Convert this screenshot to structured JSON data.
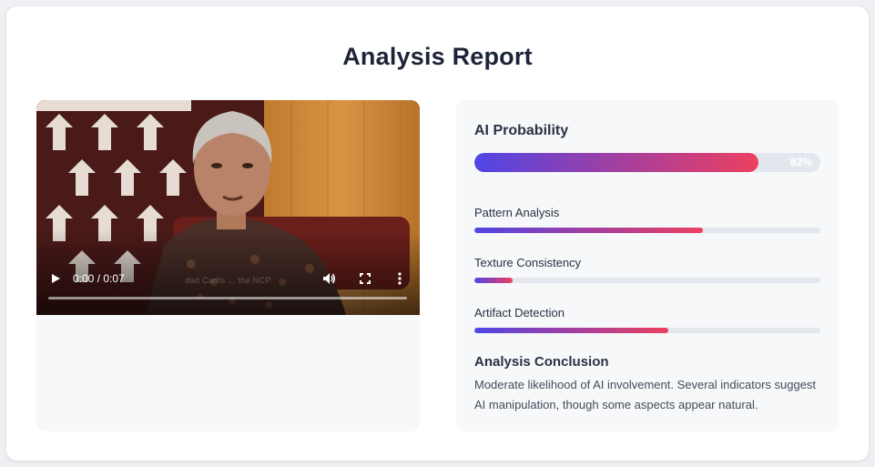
{
  "report": {
    "title": "Analysis Report"
  },
  "video": {
    "time_display": "0:00 / 0:07",
    "subtitle_text": "dad Curtis ... the NCP"
  },
  "ai_probability": {
    "label": "AI Probability",
    "value": 0.82,
    "value_label": "82%"
  },
  "metrics": [
    {
      "label": "Pattern Analysis",
      "value": 0.66
    },
    {
      "label": "Texture Consistency",
      "value": 0.11
    },
    {
      "label": "Artifact Detection",
      "value": 0.56
    }
  ],
  "conclusion": {
    "title": "Analysis Conclusion",
    "text": "Moderate likelihood of AI involvement. Several indicators suggest AI manipulation, though some aspects appear natural."
  },
  "colors": {
    "gradient_start": "#4f46e5",
    "gradient_end": "#ec4060",
    "title": "#1e2438"
  },
  "icons": {
    "play": "play-icon",
    "volume": "volume-icon",
    "fullscreen": "fullscreen-icon",
    "more": "more-vertical-icon"
  }
}
